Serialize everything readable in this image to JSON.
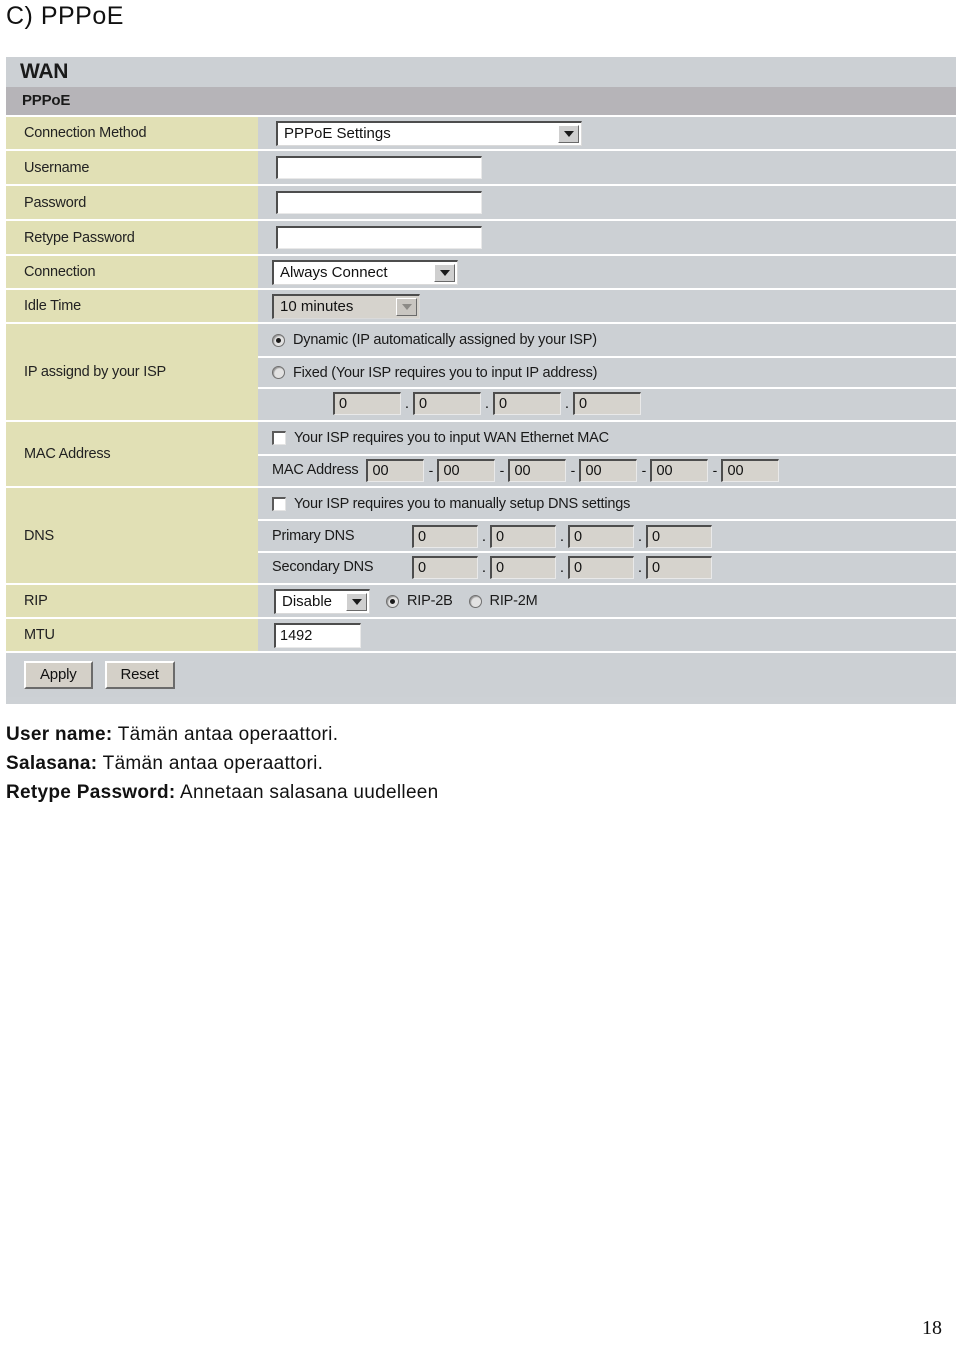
{
  "document": {
    "heading": "C) PPPoE",
    "page_number": "18"
  },
  "router_ui": {
    "panel_title": "WAN",
    "section_title": "PPPoE",
    "rows": {
      "connection_method": {
        "label": "Connection Method",
        "value": "PPPoE Settings"
      },
      "username": {
        "label": "Username",
        "value": ""
      },
      "password": {
        "label": "Password",
        "value": ""
      },
      "retype_password": {
        "label": "Retype Password",
        "value": ""
      },
      "connection": {
        "label": "Connection",
        "value": "Always Connect"
      },
      "idle_time": {
        "label": "Idle Time",
        "value": "10 minutes"
      },
      "ip_assign": {
        "label": "IP assignd by your ISP",
        "dynamic_option": "Dynamic (IP automatically assigned by your ISP)",
        "fixed_option": "Fixed (Your ISP requires you to input IP address)",
        "selected": "dynamic",
        "octets": [
          "0",
          "0",
          "0",
          "0"
        ]
      },
      "mac_address": {
        "label": "MAC Address",
        "checkbox_label": "Your ISP requires you to input WAN Ethernet MAC",
        "checked": false,
        "field_label": "MAC Address",
        "octets": [
          "00",
          "00",
          "00",
          "00",
          "00",
          "00"
        ]
      },
      "dns": {
        "label": "DNS",
        "checkbox_label": "Your ISP requires you to manually setup DNS settings",
        "checked": false,
        "primary_label": "Primary DNS",
        "primary_octets": [
          "0",
          "0",
          "0",
          "0"
        ],
        "secondary_label": "Secondary DNS",
        "secondary_octets": [
          "0",
          "0",
          "0",
          "0"
        ]
      },
      "rip": {
        "label": "RIP",
        "value": "Disable",
        "option_2b": "RIP-2B",
        "option_2m": "RIP-2M",
        "selected": "RIP-2B"
      },
      "mtu": {
        "label": "MTU",
        "value": "1492"
      }
    },
    "buttons": {
      "apply": "Apply",
      "reset": "Reset"
    }
  },
  "notes": [
    {
      "key": "User name:",
      "text": " Tämän antaa operaattori."
    },
    {
      "key": "Salasana:",
      "text": " Tämän antaa operaattori."
    },
    {
      "key": "Retype Password:",
      "text": " Annetaan salasana uudelleen"
    }
  ]
}
